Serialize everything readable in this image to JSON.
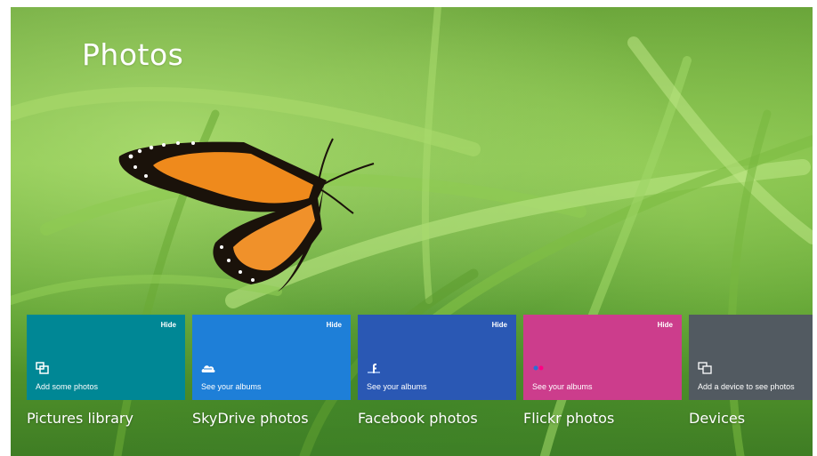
{
  "app": {
    "title": "Photos"
  },
  "tiles": [
    {
      "id": "pictures-library",
      "label": "Pictures library",
      "desc": "Add some photos",
      "hide": "Hide",
      "color": "#008795",
      "icon": "pictures-library-icon"
    },
    {
      "id": "skydrive",
      "label": "SkyDrive photos",
      "desc": "See your albums",
      "hide": "Hide",
      "color": "#1e7fd8",
      "icon": "skydrive-cloud-icon"
    },
    {
      "id": "facebook",
      "label": "Facebook photos",
      "desc": "See your albums",
      "hide": "Hide",
      "color": "#2a58b4",
      "icon": "facebook-icon"
    },
    {
      "id": "flickr",
      "label": "Flickr photos",
      "desc": "See your albums",
      "hide": "Hide",
      "color": "#cc3d8c",
      "icon": "flickr-icon"
    },
    {
      "id": "devices",
      "label": "Devices",
      "desc": "Add a device to see photos",
      "hide": "",
      "color": "#525a61",
      "icon": "devices-icon"
    }
  ]
}
